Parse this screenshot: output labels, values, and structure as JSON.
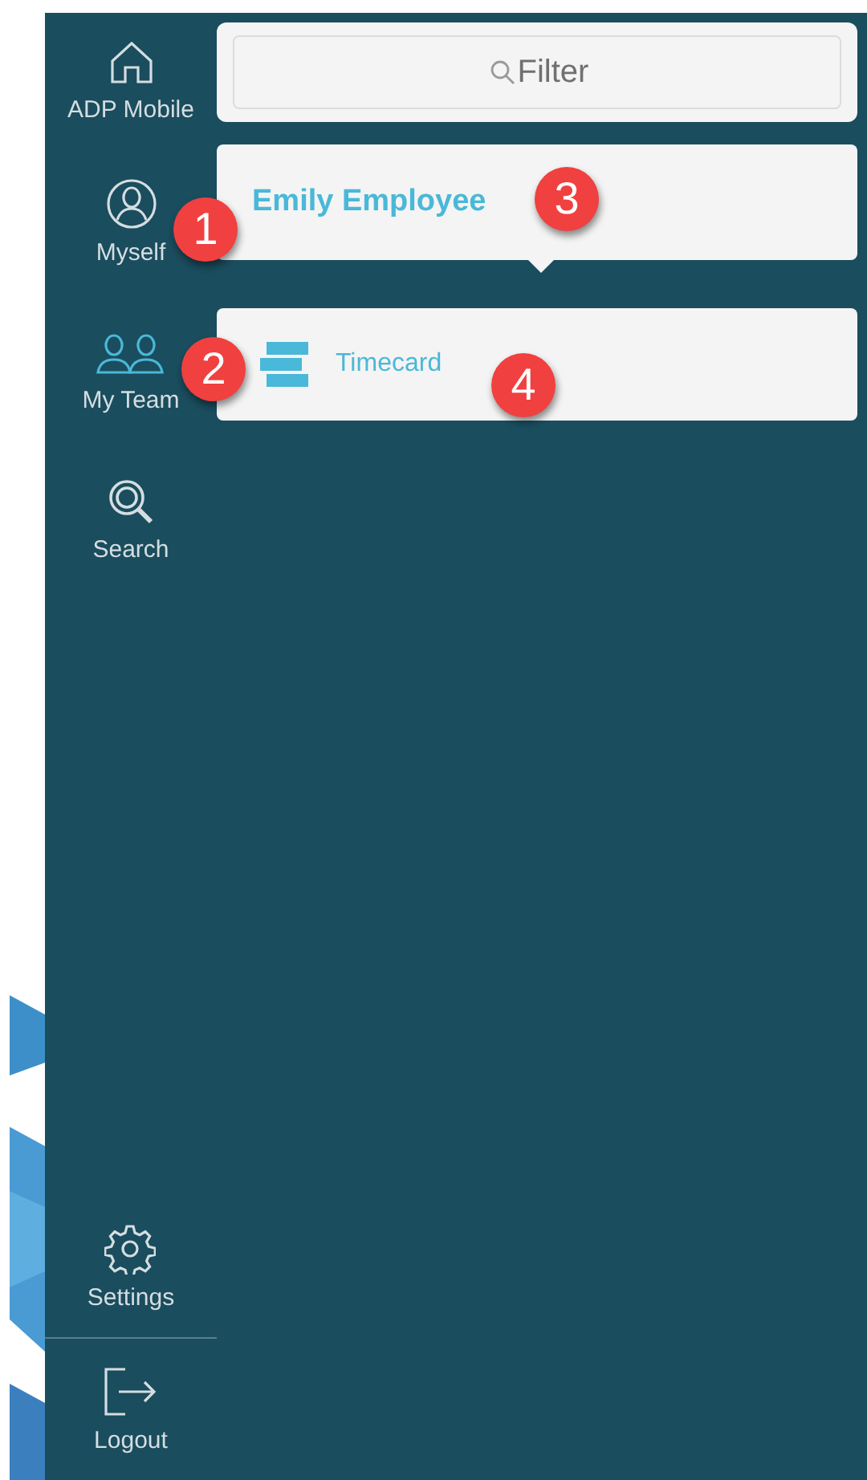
{
  "sidebar": {
    "items": [
      {
        "label": "ADP Mobile",
        "selected": false
      },
      {
        "label": "Myself",
        "selected": false
      },
      {
        "label": "My Team",
        "selected": true
      },
      {
        "label": "Search",
        "selected": false
      }
    ],
    "footer_items": [
      {
        "label": "Settings"
      },
      {
        "label": "Logout"
      }
    ]
  },
  "filter": {
    "placeholder": "Filter"
  },
  "employee_card": {
    "name": "Emily Employee"
  },
  "menu_items": [
    {
      "label": "Timecard"
    }
  ],
  "callouts": [
    {
      "label": "1"
    },
    {
      "label": "2"
    },
    {
      "label": "3"
    },
    {
      "label": "4"
    }
  ]
}
